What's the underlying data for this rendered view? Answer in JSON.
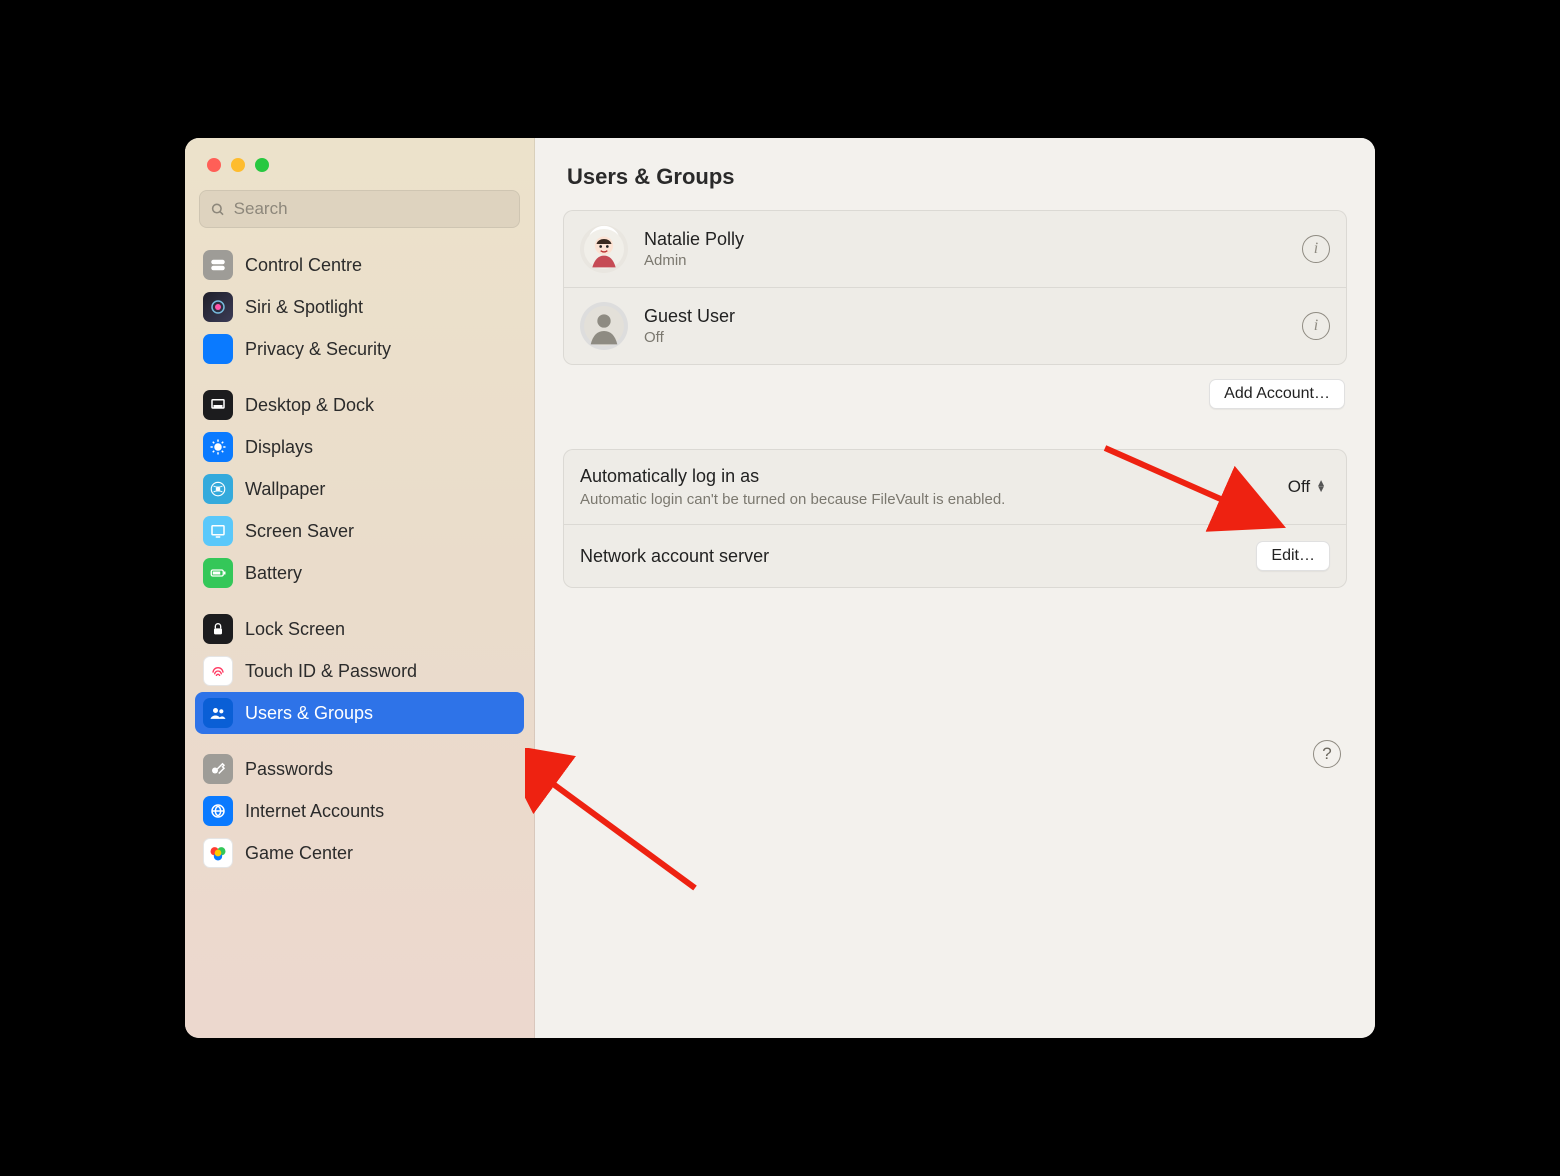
{
  "search": {
    "placeholder": "Search"
  },
  "sidebar": {
    "groups": [
      {
        "items": [
          {
            "id": "control-centre",
            "label": "Control Centre"
          },
          {
            "id": "siri-spotlight",
            "label": "Siri & Spotlight"
          },
          {
            "id": "privacy-security",
            "label": "Privacy & Security"
          }
        ]
      },
      {
        "items": [
          {
            "id": "desktop-dock",
            "label": "Desktop & Dock"
          },
          {
            "id": "displays",
            "label": "Displays"
          },
          {
            "id": "wallpaper",
            "label": "Wallpaper"
          },
          {
            "id": "screen-saver",
            "label": "Screen Saver"
          },
          {
            "id": "battery",
            "label": "Battery"
          }
        ]
      },
      {
        "items": [
          {
            "id": "lock-screen",
            "label": "Lock Screen"
          },
          {
            "id": "touch-id-password",
            "label": "Touch ID & Password"
          },
          {
            "id": "users-groups",
            "label": "Users & Groups",
            "selected": true
          }
        ]
      },
      {
        "items": [
          {
            "id": "passwords",
            "label": "Passwords"
          },
          {
            "id": "internet-accounts",
            "label": "Internet Accounts"
          },
          {
            "id": "game-center",
            "label": "Game Center"
          }
        ]
      }
    ]
  },
  "page": {
    "title": "Users & Groups"
  },
  "users": [
    {
      "name": "Natalie Polly",
      "role": "Admin",
      "avatar": "personal"
    },
    {
      "name": "Guest User",
      "role": "Off",
      "avatar": "generic"
    }
  ],
  "buttons": {
    "add_account": "Add Account…",
    "edit": "Edit…"
  },
  "settings": {
    "auto_login": {
      "label": "Automatically log in as",
      "sub": "Automatic login can't be turned on because FileVault is enabled.",
      "value": "Off"
    },
    "nas": {
      "label": "Network account server"
    }
  },
  "help": "?"
}
